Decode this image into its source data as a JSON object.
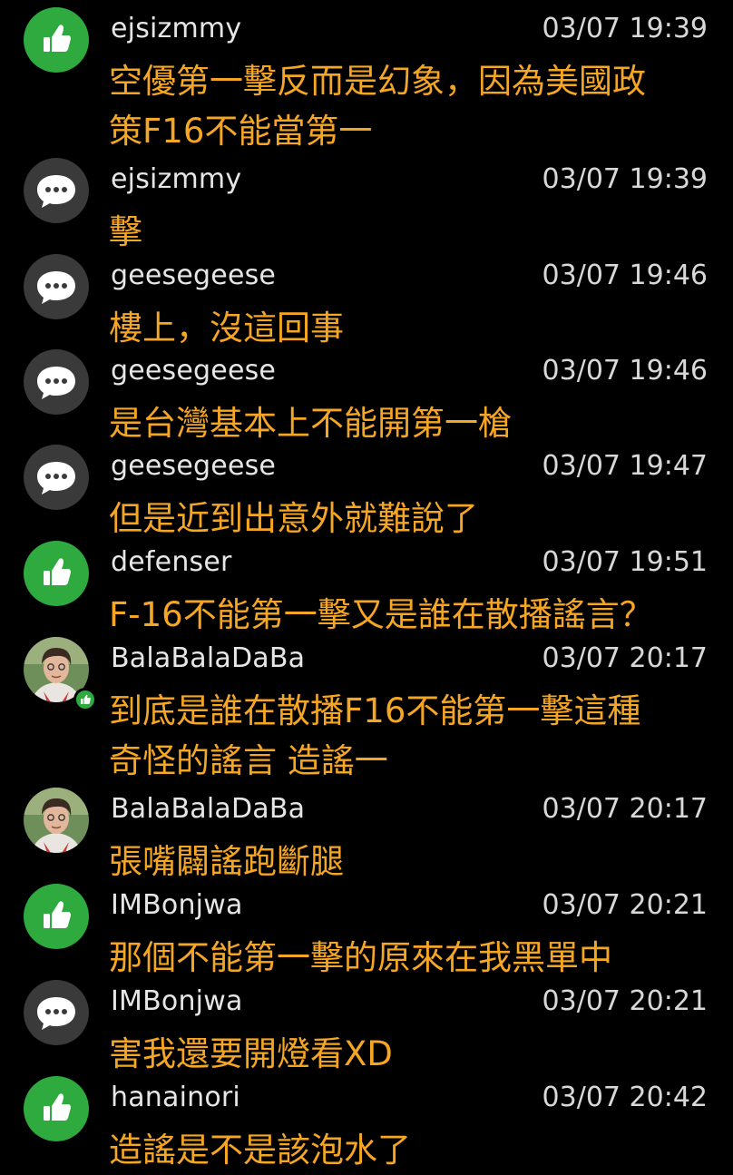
{
  "comments": [
    {
      "type": "like",
      "user": "ejsizmmy",
      "time": "03/07 19:39",
      "lines": [
        "空優第一擊反而是幻象，因為美國政",
        "策F16不能當第一"
      ]
    },
    {
      "type": "chat",
      "user": "ejsizmmy",
      "time": "03/07 19:39",
      "lines": [
        "擊"
      ]
    },
    {
      "type": "chat",
      "user": "geesegeese",
      "time": "03/07 19:46",
      "lines": [
        "樓上，沒這回事"
      ]
    },
    {
      "type": "chat",
      "user": "geesegeese",
      "time": "03/07 19:46",
      "lines": [
        "是台灣基本上不能開第一槍"
      ]
    },
    {
      "type": "chat",
      "user": "geesegeese",
      "time": "03/07 19:47",
      "lines": [
        "但是近到出意外就難說了"
      ]
    },
    {
      "type": "like",
      "user": "defenser",
      "time": "03/07 19:51",
      "lines": [
        "F-16不能第一擊又是誰在散播謠言？"
      ]
    },
    {
      "type": "photo-like",
      "user": "BalaBalaDaBa",
      "time": "03/07 20:17",
      "lines": [
        "到底是誰在散播F16不能第一擊這種",
        "奇怪的謠言 造謠一"
      ]
    },
    {
      "type": "photo",
      "user": "BalaBalaDaBa",
      "time": "03/07 20:17",
      "lines": [
        "張嘴闢謠跑斷腿"
      ]
    },
    {
      "type": "like",
      "user": "IMBonjwa",
      "time": "03/07 20:21",
      "lines": [
        "那個不能第一擊的原來在我黑單中"
      ]
    },
    {
      "type": "chat",
      "user": "IMBonjwa",
      "time": "03/07 20:21",
      "lines": [
        "害我還要開燈看XD"
      ]
    },
    {
      "type": "like",
      "user": "hanainori",
      "time": "03/07 20:42",
      "lines": [
        "造謠是不是該泡水了"
      ]
    }
  ]
}
